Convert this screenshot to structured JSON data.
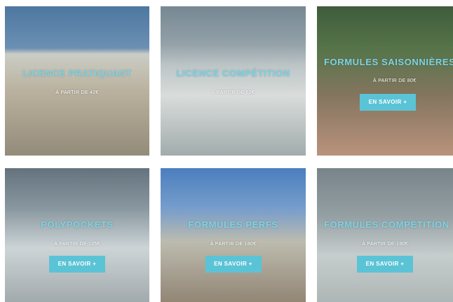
{
  "cards": [
    {
      "title": "LICENCE PRATIQUANT",
      "price": "À PARTIR DE 42€",
      "button": ""
    },
    {
      "title": "LICENCE COMPÉTITION",
      "price": "À PARTIR DE 52€",
      "button": ""
    },
    {
      "title": "FORMULES SAISONNIÈRES",
      "price": "À PARTIR DE 80€",
      "button": "EN SAVOIR +"
    },
    {
      "title": "POLYPOCKETS",
      "price": "À PARTIR DE 125€",
      "button": "EN SAVOIR +"
    },
    {
      "title": "FORMULES PERFS",
      "price": "À PARTIR DE 180€",
      "button": "EN SAVOIR +"
    },
    {
      "title": "FORMULES COMPÉTITION",
      "price": "À PARTIR DE 190€",
      "button": "EN SAVOIR +"
    }
  ],
  "colors": {
    "accent": "#5bc3d6",
    "title": "#7dd3e3"
  }
}
